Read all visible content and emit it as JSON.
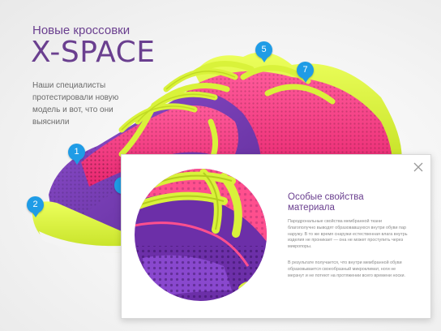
{
  "header": {
    "subtitle": "Новые кроссовки",
    "title": "X-SPACE",
    "intro": "Наши специалисты протестировали новую модель и вот, что они выяснили"
  },
  "hotspots": [
    {
      "number": "1"
    },
    {
      "number": "2"
    },
    {
      "number": "5"
    },
    {
      "number": "7"
    }
  ],
  "popup": {
    "title": "Особые свойства материала",
    "paragraph1": "Пародрональные свойства мембранной ткани благополучно выводят образовавшуюся внутри обуви пар наружу. В то же время снаружи естественная влага внутрь изделия не проникает — она не может проступить через микропоры.",
    "paragraph2": "В результате получается, что внутри мембранной обуви образовывается своеобразный микроклимат, ноги не мерзнут и не потеют на протяжении всего времени носки.",
    "close_icon": "close-icon"
  },
  "colors": {
    "accent_purple": "#6a3f8f",
    "hotspot_blue": "#1f9ce6",
    "shoe_pink": "#ff3f86",
    "shoe_lime": "#d9f23a",
    "shoe_purple": "#7a3fb4"
  }
}
